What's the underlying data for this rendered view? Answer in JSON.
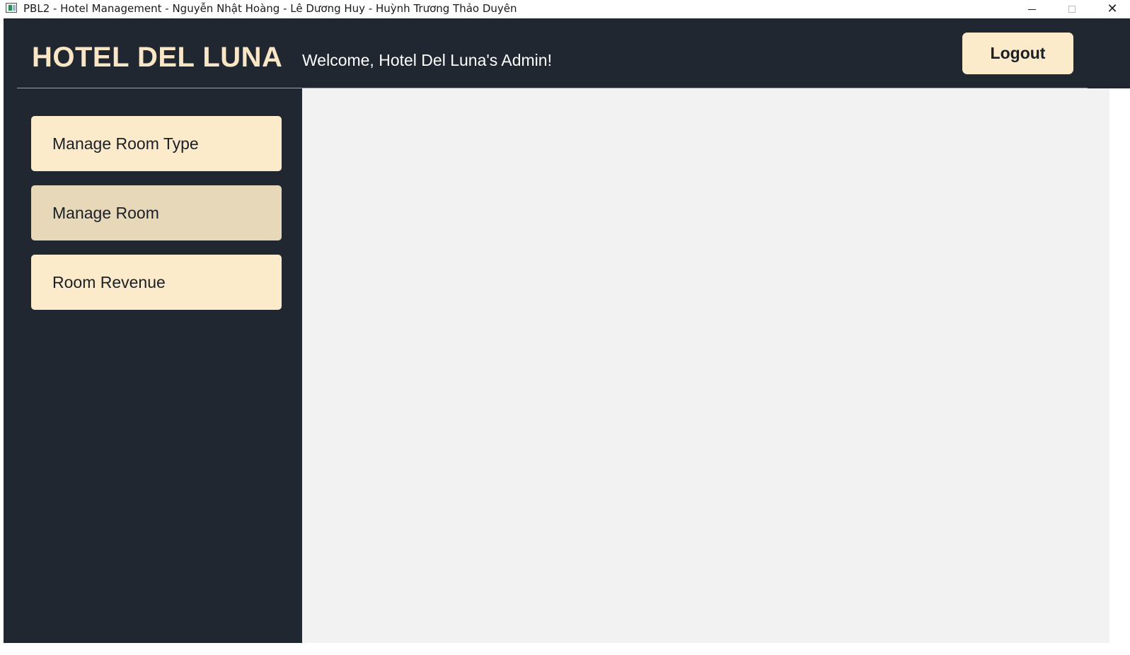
{
  "window": {
    "title": "PBL2 - Hotel Management - Nguyễn Nhật Hoàng - Lê Dương Huy - Huỳnh Trương Thảo Duyên",
    "app_icon": "app-window-icon",
    "controls": {
      "minimize": "minimize-icon",
      "maximize": "maximize-icon",
      "close": "close-icon",
      "close_glyph": "✕"
    }
  },
  "header": {
    "brand": "HOTEL DEL LUNA",
    "welcome": "Welcome, Hotel Del Luna's Admin!",
    "logout_label": "Logout"
  },
  "sidebar": {
    "items": [
      {
        "label": "Manage Room Type",
        "active": false
      },
      {
        "label": "Manage Room",
        "active": true
      },
      {
        "label": "Room Revenue",
        "active": false
      }
    ]
  },
  "colors": {
    "dark_bg": "#212731",
    "button_bg": "#fcebcb",
    "button_active_bg": "#e6d8b9",
    "brand_text": "#f9e6c6",
    "content_bg": "#f2f2f2"
  }
}
